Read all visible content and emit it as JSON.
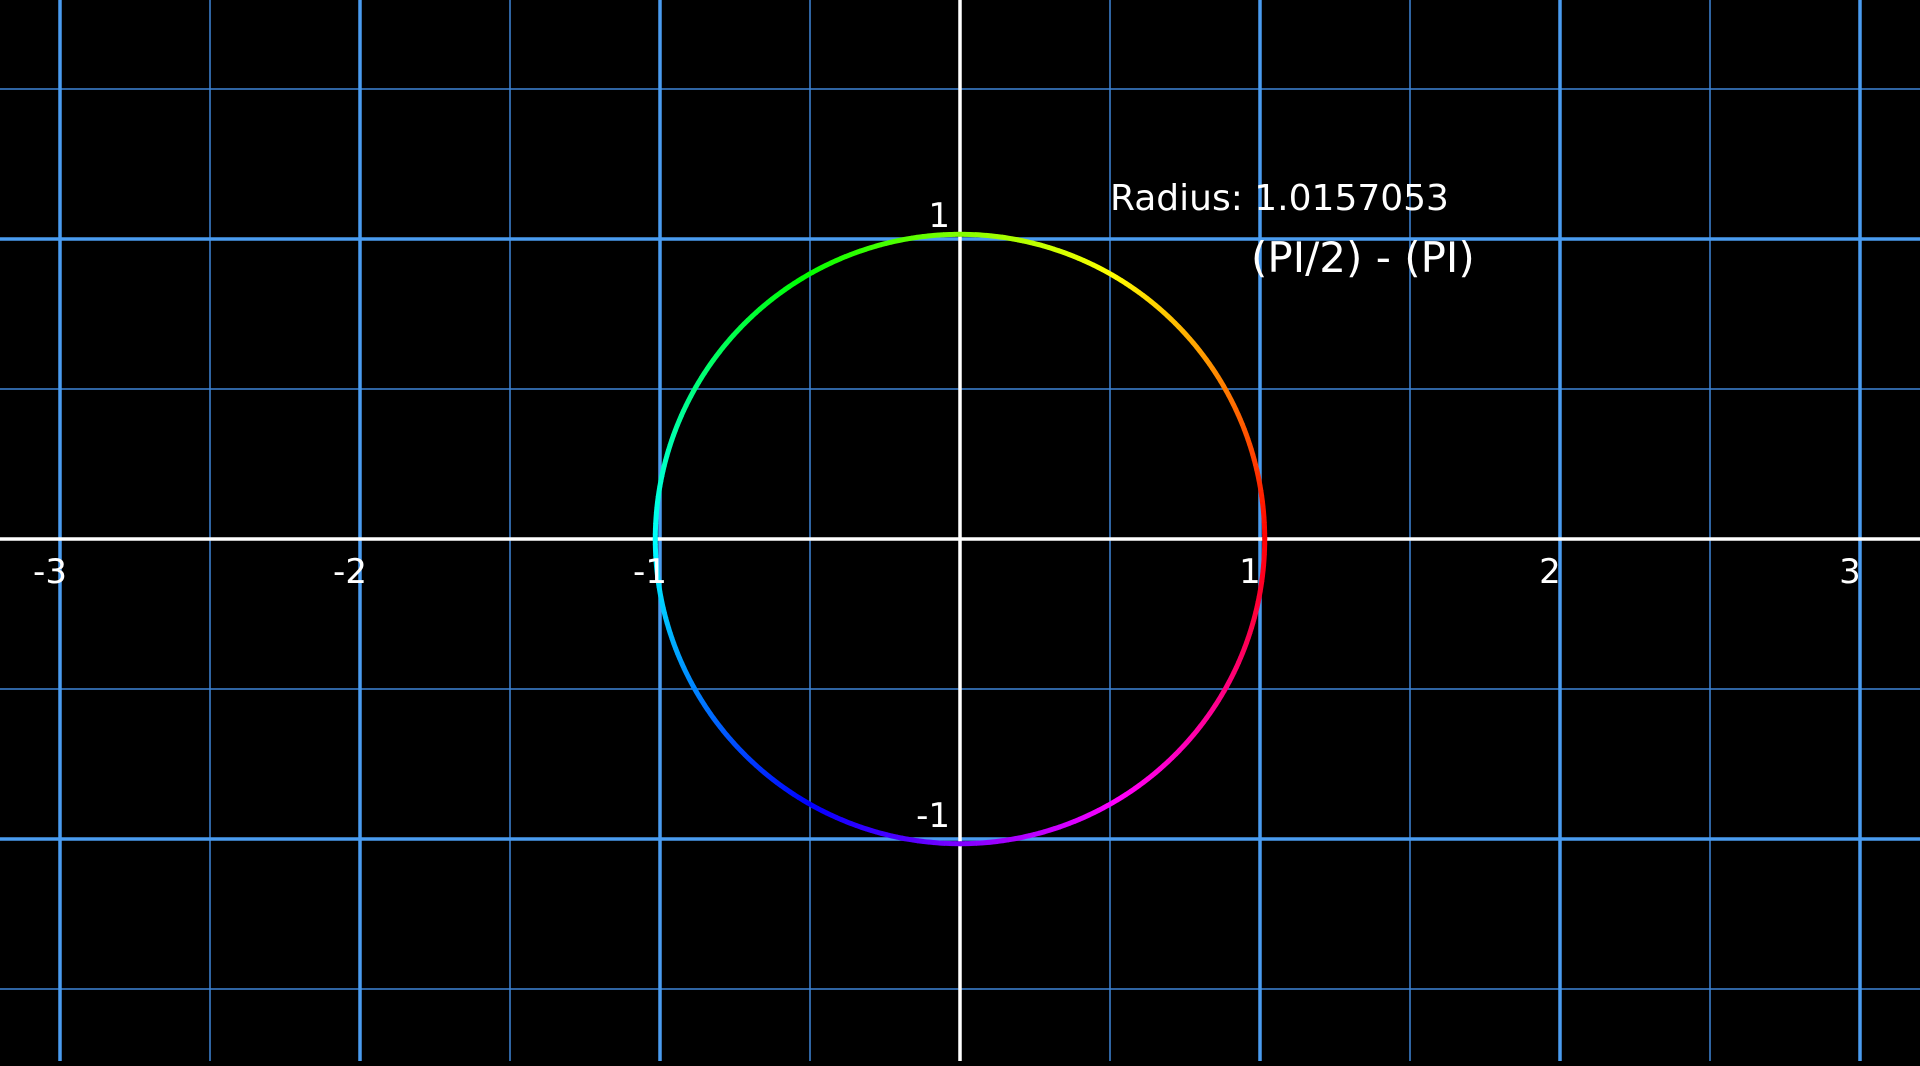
{
  "readout": {
    "radius_label": "Radius: 1.0157053",
    "expression": "(PI/2) - (PI)"
  },
  "plane": {
    "x_range": [
      -3.2,
      3.2
    ],
    "y_range": [
      -1.75,
      1.8
    ],
    "major_step": 1,
    "minor_step": 0.5,
    "grid": true,
    "x_tick_labels": [
      {
        "value": -3,
        "text": "-3"
      },
      {
        "value": -2,
        "text": "-2"
      },
      {
        "value": -1,
        "text": "-1"
      },
      {
        "value": 1,
        "text": "1"
      },
      {
        "value": 2,
        "text": "2"
      },
      {
        "value": 3,
        "text": "3"
      }
    ],
    "y_tick_labels": [
      {
        "value": 1,
        "text": "1"
      },
      {
        "value": -1,
        "text": "-1"
      }
    ]
  },
  "circle": {
    "radius": 1.0157053,
    "center": [
      0,
      0
    ],
    "coloring": "hue by angle (red at 0, yellow at PI/2, green, cyan at PI, blue, magenta)"
  },
  "colors": {
    "background": "#000000",
    "grid_major": "#4a9cf0",
    "grid_minor": "#3f86d8",
    "axes": "#ffffff",
    "text": "#ffffff"
  }
}
